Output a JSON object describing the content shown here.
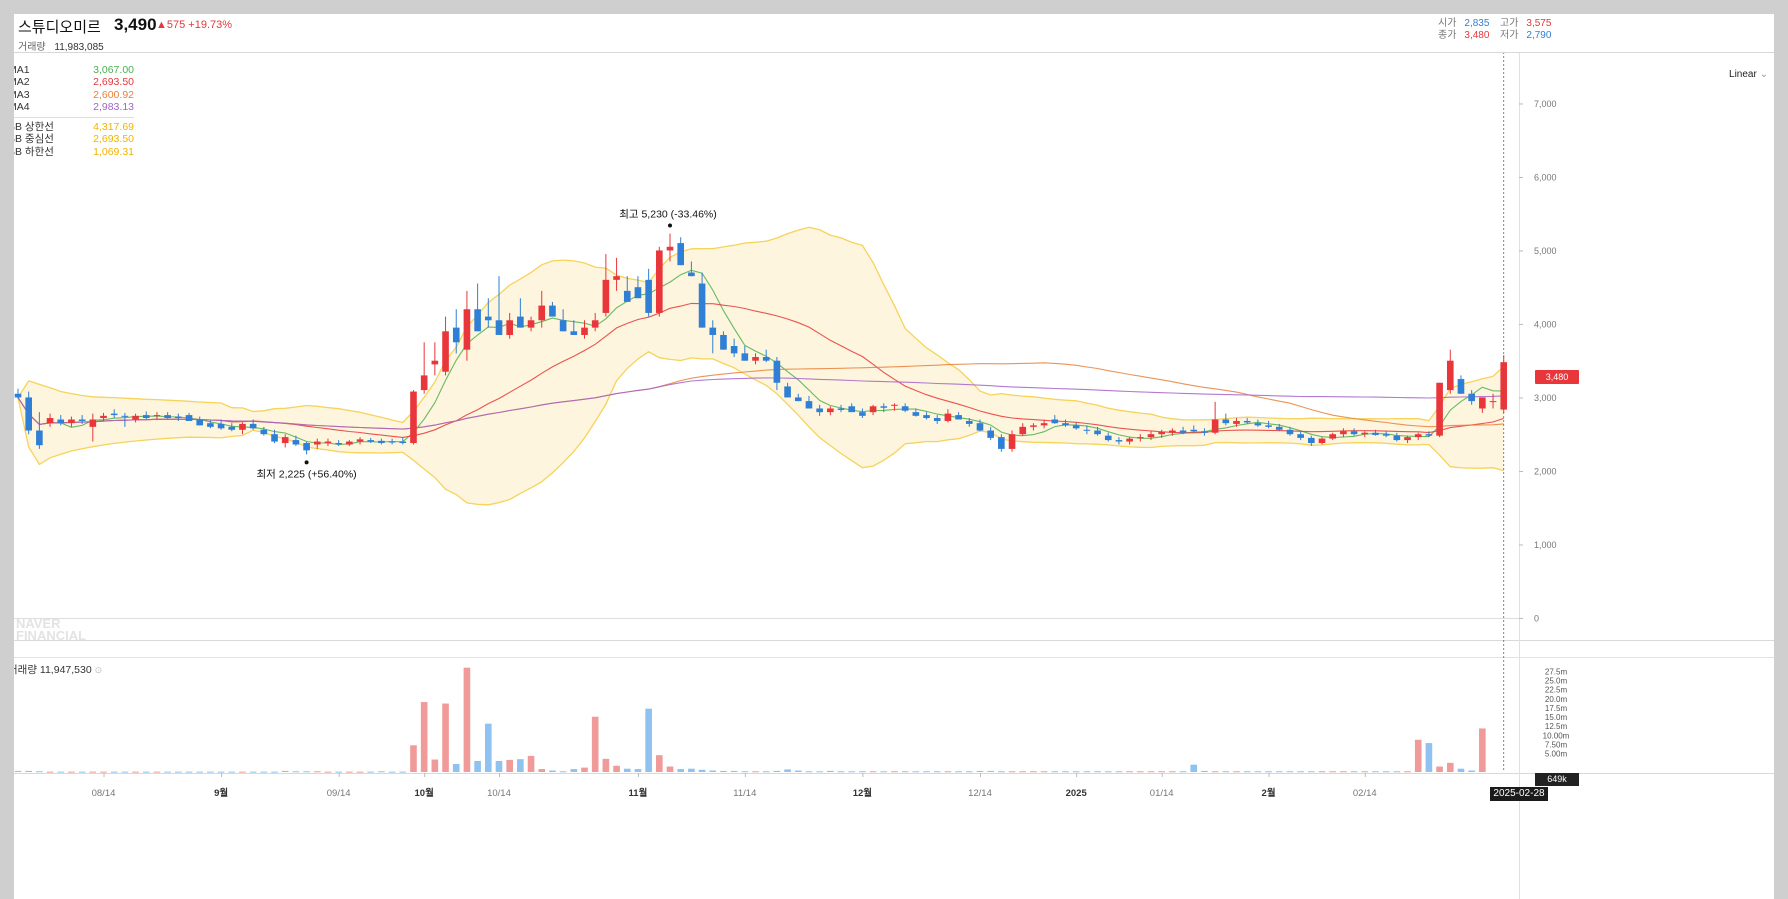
{
  "header": {
    "name": "스튜디오미르",
    "price": "3,490",
    "change": "▲575 +19.73%",
    "volume_label": "거래량",
    "volume_value": "11,983,085",
    "ohlc": {
      "open_label": "시가",
      "open": "2,835",
      "high_label": "고가",
      "high": "3,575",
      "close_label": "종가",
      "close": "3,480",
      "low_label": "저가",
      "low": "2,790"
    }
  },
  "legend": {
    "ma": [
      {
        "name": "MA1",
        "value": "3,067.00",
        "color": "#4caf50"
      },
      {
        "name": "MA2",
        "value": "2,693.50",
        "color": "#e8363b"
      },
      {
        "name": "MA3",
        "value": "2,600.92",
        "color": "#e8803b"
      },
      {
        "name": "MA4",
        "value": "2,983.13",
        "color": "#a463c9"
      }
    ],
    "bb": [
      {
        "name": "BB 상한선",
        "value": "4,317.69",
        "color": "#f0b400"
      },
      {
        "name": "BB 중심선",
        "value": "2,693.50",
        "color": "#f0b400"
      },
      {
        "name": "BB 하한선",
        "value": "1,069.31",
        "color": "#f0b400"
      }
    ]
  },
  "scale_mode": "Linear",
  "watermark": [
    "NAVER",
    "FINANCIAL"
  ],
  "volume_panel": {
    "label": "거래량",
    "value": "11,947,530"
  },
  "current_price_tag": "3,480",
  "current_volume_tag": "649k",
  "current_date_tag": "2025-02-28",
  "annotations": {
    "high": "최고 5,230 (-33.46%)",
    "low": "최저 2,225 (+56.40%)"
  },
  "colors": {
    "up": "#e8363b",
    "down": "#2f7fd6",
    "bb_fill": "#fdf5dd",
    "bb_line": "#f6d35a"
  },
  "chart_data": {
    "type": "candlestick",
    "ylim": [
      -300,
      7700
    ],
    "y_ticks": [
      "0",
      "1,000",
      "2,000",
      "3,000",
      "4,000",
      "5,000",
      "6,000",
      "7,000"
    ],
    "y_tick_values": [
      0,
      1000,
      2000,
      3000,
      4000,
      5000,
      6000,
      7000
    ],
    "x_ticks": [
      "08/14",
      "9월",
      "09/14",
      "10월",
      "10/14",
      "11월",
      "11/14",
      "12월",
      "12/14",
      "2025",
      "01/14",
      "2월",
      "02/14"
    ],
    "x_tick_index": [
      8,
      19,
      30,
      38,
      45,
      58,
      68,
      79,
      90,
      99,
      107,
      117,
      126
    ],
    "volume_ticks": [
      "5.00m",
      "7.50m",
      "10.00m",
      "12.5m",
      "15.0m",
      "17.5m",
      "20.0m",
      "22.5m",
      "25.0m",
      "27.5m"
    ],
    "volume_tick_values": [
      5,
      7.5,
      10,
      12.5,
      15,
      17.5,
      20,
      22.5,
      25,
      27.5
    ],
    "ohlc": [
      [
        3050,
        3120,
        2980,
        3000
      ],
      [
        3000,
        3080,
        2500,
        2550
      ],
      [
        2550,
        2800,
        2300,
        2350
      ],
      [
        2650,
        2780,
        2600,
        2720
      ],
      [
        2700,
        2760,
        2620,
        2650
      ],
      [
        2650,
        2740,
        2600,
        2700
      ],
      [
        2700,
        2760,
        2640,
        2680
      ],
      [
        2600,
        2780,
        2400,
        2700
      ],
      [
        2720,
        2790,
        2680,
        2750
      ],
      [
        2780,
        2840,
        2720,
        2760
      ],
      [
        2750,
        2790,
        2600,
        2740
      ],
      [
        2700,
        2780,
        2660,
        2750
      ],
      [
        2760,
        2810,
        2700,
        2720
      ],
      [
        2750,
        2800,
        2700,
        2760
      ],
      [
        2760,
        2800,
        2710,
        2720
      ],
      [
        2740,
        2780,
        2680,
        2720
      ],
      [
        2760,
        2790,
        2700,
        2680
      ],
      [
        2700,
        2740,
        2620,
        2620
      ],
      [
        2650,
        2700,
        2580,
        2600
      ],
      [
        2640,
        2700,
        2560,
        2580
      ],
      [
        2600,
        2650,
        2540,
        2560
      ],
      [
        2560,
        2660,
        2500,
        2640
      ],
      [
        2640,
        2700,
        2560,
        2580
      ],
      [
        2560,
        2600,
        2480,
        2500
      ],
      [
        2500,
        2560,
        2380,
        2400
      ],
      [
        2380,
        2500,
        2320,
        2460
      ],
      [
        2420,
        2480,
        2340,
        2360
      ],
      [
        2380,
        2400,
        2225,
        2280
      ],
      [
        2360,
        2440,
        2300,
        2400
      ],
      [
        2380,
        2440,
        2340,
        2400
      ],
      [
        2380,
        2420,
        2340,
        2360
      ],
      [
        2360,
        2420,
        2340,
        2400
      ],
      [
        2400,
        2460,
        2360,
        2430
      ],
      [
        2420,
        2450,
        2380,
        2400
      ],
      [
        2410,
        2440,
        2360,
        2380
      ],
      [
        2400,
        2440,
        2360,
        2390
      ],
      [
        2400,
        2460,
        2360,
        2380
      ],
      [
        2380,
        3100,
        2360,
        3080
      ],
      [
        3100,
        3750,
        3050,
        3300
      ],
      [
        3450,
        3750,
        3300,
        3500
      ],
      [
        3350,
        4100,
        3300,
        3900
      ],
      [
        3950,
        4200,
        3600,
        3750
      ],
      [
        3650,
        4450,
        3500,
        4200
      ],
      [
        4200,
        4550,
        3900,
        3900
      ],
      [
        4100,
        4350,
        3950,
        4050
      ],
      [
        4050,
        4650,
        3950,
        3850
      ],
      [
        3850,
        4150,
        3800,
        4050
      ],
      [
        4100,
        4350,
        3950,
        3950
      ],
      [
        3950,
        4100,
        3900,
        4050
      ],
      [
        4050,
        4450,
        3950,
        4250
      ],
      [
        4250,
        4300,
        4150,
        4100
      ],
      [
        4050,
        4200,
        3900,
        3900
      ],
      [
        3900,
        4050,
        3850,
        3850
      ],
      [
        3850,
        4050,
        3800,
        3950
      ],
      [
        3950,
        4150,
        3900,
        4050
      ],
      [
        4150,
        4950,
        4100,
        4600
      ],
      [
        4600,
        4900,
        4450,
        4650
      ],
      [
        4450,
        4650,
        4300,
        4300
      ],
      [
        4500,
        4650,
        4400,
        4350
      ],
      [
        4600,
        4750,
        4100,
        4150
      ],
      [
        4150,
        5050,
        4100,
        5000
      ],
      [
        5000,
        5230,
        4850,
        5050
      ],
      [
        5100,
        5180,
        4800,
        4800
      ],
      [
        4700,
        4850,
        4650,
        4650
      ],
      [
        4550,
        4700,
        3950,
        3950
      ],
      [
        3950,
        4050,
        3600,
        3850
      ],
      [
        3850,
        3900,
        3650,
        3650
      ],
      [
        3700,
        3800,
        3550,
        3600
      ],
      [
        3600,
        3700,
        3500,
        3500
      ],
      [
        3500,
        3600,
        3450,
        3550
      ],
      [
        3550,
        3650,
        3480,
        3500
      ],
      [
        3500,
        3550,
        3100,
        3200
      ],
      [
        3150,
        3200,
        3000,
        3000
      ],
      [
        3000,
        3050,
        2950,
        2950
      ],
      [
        2950,
        3020,
        2850,
        2850
      ],
      [
        2850,
        2900,
        2750,
        2800
      ],
      [
        2800,
        2880,
        2760,
        2850
      ],
      [
        2850,
        2900,
        2800,
        2830
      ],
      [
        2880,
        2920,
        2820,
        2800
      ],
      [
        2800,
        2850,
        2720,
        2750
      ],
      [
        2800,
        2900,
        2760,
        2880
      ],
      [
        2880,
        2920,
        2800,
        2860
      ],
      [
        2890,
        2920,
        2820,
        2900
      ],
      [
        2880,
        2920,
        2800,
        2820
      ],
      [
        2800,
        2850,
        2740,
        2750
      ],
      [
        2760,
        2800,
        2700,
        2720
      ],
      [
        2720,
        2760,
        2640,
        2680
      ],
      [
        2680,
        2840,
        2660,
        2780
      ],
      [
        2760,
        2800,
        2700,
        2700
      ],
      [
        2680,
        2720,
        2600,
        2640
      ],
      [
        2650,
        2700,
        2540,
        2550
      ],
      [
        2550,
        2600,
        2420,
        2450
      ],
      [
        2460,
        2500,
        2260,
        2300
      ],
      [
        2300,
        2550,
        2260,
        2500
      ],
      [
        2500,
        2650,
        2480,
        2600
      ],
      [
        2600,
        2650,
        2550,
        2620
      ],
      [
        2620,
        2700,
        2580,
        2650
      ],
      [
        2700,
        2760,
        2640,
        2650
      ],
      [
        2650,
        2700,
        2600,
        2620
      ],
      [
        2620,
        2660,
        2560,
        2580
      ],
      [
        2560,
        2620,
        2500,
        2550
      ],
      [
        2550,
        2600,
        2480,
        2500
      ],
      [
        2480,
        2520,
        2400,
        2420
      ],
      [
        2420,
        2460,
        2360,
        2400
      ],
      [
        2400,
        2460,
        2360,
        2440
      ],
      [
        2450,
        2500,
        2400,
        2460
      ],
      [
        2460,
        2540,
        2420,
        2500
      ],
      [
        2500,
        2560,
        2450,
        2530
      ],
      [
        2520,
        2580,
        2480,
        2550
      ],
      [
        2550,
        2600,
        2500,
        2520
      ],
      [
        2560,
        2620,
        2520,
        2540
      ],
      [
        2540,
        2580,
        2480,
        2520
      ],
      [
        2520,
        2940,
        2500,
        2700
      ],
      [
        2700,
        2780,
        2620,
        2650
      ],
      [
        2640,
        2720,
        2600,
        2680
      ],
      [
        2680,
        2720,
        2640,
        2660
      ],
      [
        2650,
        2700,
        2600,
        2620
      ],
      [
        2620,
        2680,
        2580,
        2600
      ],
      [
        2600,
        2640,
        2540,
        2560
      ],
      [
        2560,
        2600,
        2480,
        2500
      ],
      [
        2500,
        2540,
        2420,
        2450
      ],
      [
        2450,
        2480,
        2340,
        2380
      ],
      [
        2380,
        2460,
        2360,
        2440
      ],
      [
        2440,
        2520,
        2420,
        2500
      ],
      [
        2500,
        2580,
        2460,
        2540
      ],
      [
        2540,
        2580,
        2480,
        2500
      ],
      [
        2500,
        2540,
        2460,
        2520
      ],
      [
        2520,
        2560,
        2480,
        2490
      ],
      [
        2500,
        2540,
        2460,
        2480
      ],
      [
        2480,
        2520,
        2400,
        2420
      ],
      [
        2420,
        2480,
        2380,
        2460
      ],
      [
        2460,
        2520,
        2420,
        2500
      ],
      [
        2500,
        2540,
        2460,
        2480
      ],
      [
        2480,
        3200,
        2460,
        3200
      ],
      [
        3100,
        3650,
        3050,
        3500
      ],
      [
        3250,
        3300,
        3050,
        3050
      ],
      [
        3050,
        3100,
        2900,
        2950
      ],
      [
        2850,
        3000,
        2790,
        3000
      ],
      [
        2950,
        3050,
        2850,
        2950
      ],
      [
        2835,
        3575,
        2790,
        3480
      ]
    ],
    "volume_m": [
      0.3,
      0.3,
      0.2,
      0.1,
      0.1,
      0.1,
      0.1,
      0.1,
      0.1,
      0.1,
      0.1,
      0.1,
      0.1,
      0.1,
      0.1,
      0.1,
      0.1,
      0.1,
      0.1,
      0.1,
      0.1,
      0.1,
      0.1,
      0.1,
      0.1,
      0.3,
      0.2,
      0.2,
      0.2,
      0.1,
      0.1,
      0.1,
      0.1,
      0.1,
      0.2,
      0.1,
      0.1,
      7.3,
      19.1,
      3.4,
      18.7,
      2.2,
      28.5,
      3.0,
      13.2,
      3.0,
      3.3,
      3.5,
      4.4,
      0.8,
      0.4,
      0.2,
      0.8,
      1.2,
      15.1,
      3.6,
      1.7,
      0.9,
      0.8,
      17.3,
      4.6,
      1.5,
      0.8,
      0.9,
      0.6,
      0.4,
      0.3,
      0.3,
      0.2,
      0.2,
      0.2,
      0.3,
      0.7,
      0.4,
      0.2,
      0.2,
      0.3,
      0.2,
      0.2,
      0.2,
      0.2,
      0.2,
      0.2,
      0.2,
      0.2,
      0.2,
      0.2,
      0.2,
      0.2,
      0.2,
      0.3,
      0.3,
      0.2,
      0.2,
      0.2,
      0.2,
      0.2,
      0.2,
      0.2,
      0.2,
      0.2,
      0.2,
      0.2,
      0.2,
      0.2,
      0.2,
      0.2,
      0.2,
      0.2,
      0.2,
      2.0,
      0.3,
      0.2,
      0.2,
      0.2,
      0.2,
      0.2,
      0.2,
      0.2,
      0.2,
      0.2,
      0.2,
      0.2,
      0.2,
      0.2,
      0.2,
      0.2,
      0.2,
      0.2,
      0.2,
      0.2,
      8.8,
      7.9,
      1.5,
      2.5,
      0.9,
      0.4,
      11.9
    ],
    "ma_windows": [
      5,
      20,
      60,
      120
    ]
  }
}
